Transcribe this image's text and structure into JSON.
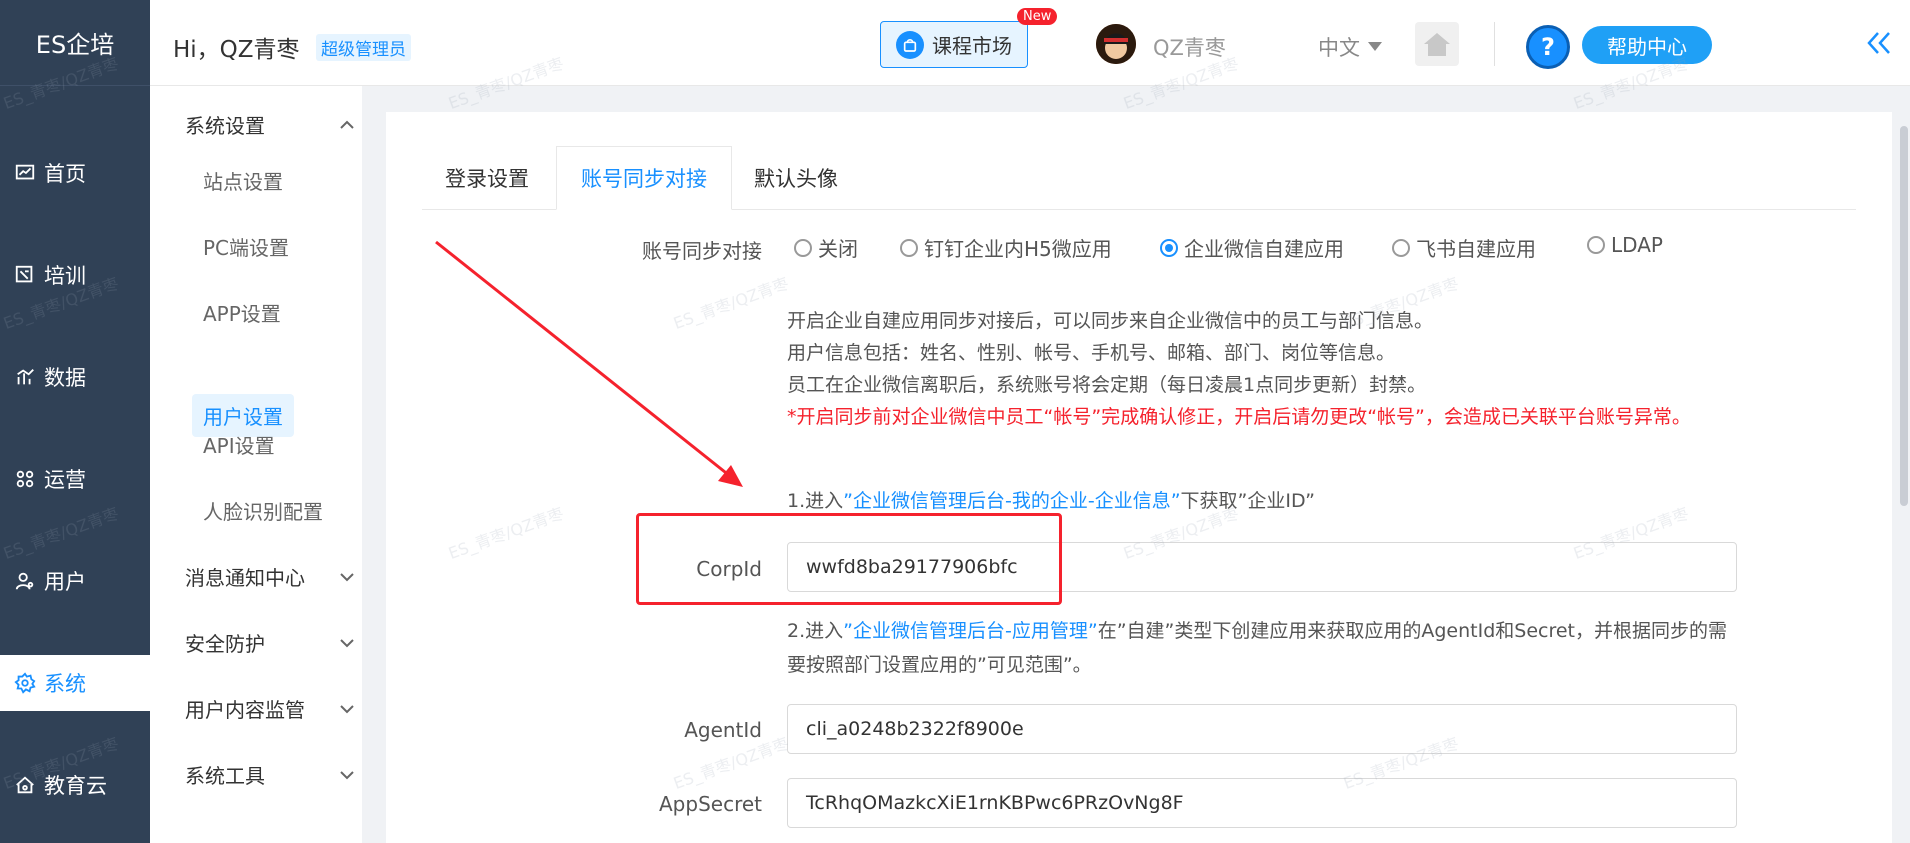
{
  "brand": "ES企培",
  "left_nav": [
    {
      "label": "首页",
      "icon": "chart-icon",
      "active": false
    },
    {
      "label": "培训",
      "icon": "training-icon",
      "active": false
    },
    {
      "label": "数据",
      "icon": "data-icon",
      "active": false
    },
    {
      "label": "运营",
      "icon": "operation-icon",
      "active": false
    },
    {
      "label": "用户",
      "icon": "user-icon",
      "active": false
    },
    {
      "label": "系统",
      "icon": "gear-icon",
      "active": true
    },
    {
      "label": "教育云",
      "icon": "cloud-icon",
      "active": false
    }
  ],
  "header": {
    "greeting": "Hi，QZ青枣",
    "role": "超级管理员",
    "market_label": "课程市场",
    "new_badge": "New",
    "username": "QZ青枣",
    "language": "中文",
    "help_label": "帮助中心"
  },
  "sub_nav": {
    "group_system": "系统设置",
    "items": [
      "站点设置",
      "PC端设置",
      "APP设置",
      "用户设置",
      "API设置",
      "人脸识别配置"
    ],
    "active_item": "用户设置",
    "groups": [
      "消息通知中心",
      "安全防护",
      "用户内容监管",
      "系统工具"
    ]
  },
  "tabs": [
    {
      "label": "登录设置",
      "active": false
    },
    {
      "label": "账号同步对接",
      "active": true
    },
    {
      "label": "默认头像",
      "active": false
    }
  ],
  "form": {
    "sync_label": "账号同步对接",
    "radios": [
      {
        "label": "关闭",
        "checked": false
      },
      {
        "label": "钉钉企业内H5微应用",
        "checked": false
      },
      {
        "label": "企业微信自建应用",
        "checked": true
      },
      {
        "label": "飞书自建应用",
        "checked": false
      },
      {
        "label": "LDAP",
        "checked": false
      }
    ],
    "info_lines": [
      "开启企业自建应用同步对接后，可以同步来自企业微信中的员工与部门信息。",
      "用户信息包括：姓名、性别、帐号、手机号、邮箱、部门、岗位等信息。",
      "员工在企业微信离职后，系统账号将会定期（每日凌晨1点同步更新）封禁。"
    ],
    "warning": "*开启同步前对企业微信中员工“帐号”完成确认修正，开启后请勿更改“帐号”，会造成已关联平台账号异常。",
    "step1_prefix": "1.进入",
    "step1_link": "”企业微信管理后台-我的企业-企业信息”",
    "step1_suffix": "下获取”企业ID”",
    "corpid_label": "CorpId",
    "corpid_value": "wwfd8ba29177906bfc",
    "step2_prefix": "2.进入",
    "step2_link": "”企业微信管理后台-应用管理”",
    "step2_suffix": "在”自建”类型下创建应用来获取应用的AgentId和Secret，并根据同步的需要按照部门设置应用的”可见范围”。",
    "agentid_label": "AgentId",
    "agentid_value": "cli_a0248b2322f8900e",
    "appsecret_label": "AppSecret",
    "appsecret_value": "TcRhqOMazkcXiE1rnKBPwc6PRzOvNg8F"
  },
  "watermark": "ES_青枣/QZ青枣",
  "colors": {
    "primary": "#1890ff",
    "sidebar": "#304156",
    "warn": "#f5222d"
  }
}
